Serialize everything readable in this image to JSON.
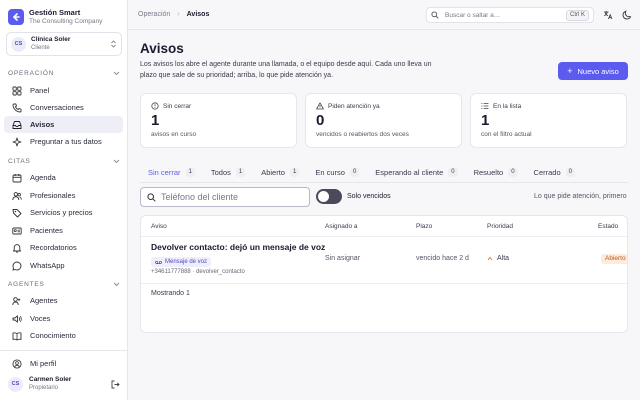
{
  "brand": {
    "name": "Gestión Smart",
    "subtitle": "The Consulting Company"
  },
  "client": {
    "initials": "CS",
    "name": "Clínica Soler",
    "role": "Cliente"
  },
  "sidebar": {
    "sections": [
      {
        "label": "OPERACIÓN",
        "items": [
          {
            "label": "Panel",
            "icon": "grid-icon"
          },
          {
            "label": "Conversaciones",
            "icon": "phone-icon"
          },
          {
            "label": "Avisos",
            "icon": "inbox-icon",
            "active": true
          },
          {
            "label": "Preguntar a tus datos",
            "icon": "sparkle-icon"
          }
        ]
      },
      {
        "label": "CITAS",
        "items": [
          {
            "label": "Agenda",
            "icon": "calendar-icon"
          },
          {
            "label": "Profesionales",
            "icon": "users-icon"
          },
          {
            "label": "Servicios y precios",
            "icon": "tag-icon"
          },
          {
            "label": "Pacientes",
            "icon": "id-card-icon"
          },
          {
            "label": "Recordatorios",
            "icon": "bell-icon"
          },
          {
            "label": "WhatsApp",
            "icon": "whatsapp-icon"
          }
        ]
      },
      {
        "label": "AGENTES",
        "items": [
          {
            "label": "Agentes",
            "icon": "agents-icon"
          },
          {
            "label": "Voces",
            "icon": "voice-icon"
          },
          {
            "label": "Conocimiento",
            "icon": "book-icon"
          }
        ]
      }
    ],
    "profile_label": "Mi perfil",
    "user": {
      "initials": "CS",
      "name": "Carmen Soler",
      "role": "Propietario"
    }
  },
  "topbar": {
    "breadcrumb": [
      "Operación",
      "Avisos"
    ],
    "search_placeholder": "Buscar o saltar a…",
    "shortcut": "Ctrl K"
  },
  "page": {
    "title": "Avisos",
    "description": "Los avisos los abre el agente durante una llamada, o el equipo desde aquí. Cada uno lleva un plazo que sale de su prioridad; arriba, lo que pide atención ya.",
    "new_button": "Nuevo aviso"
  },
  "stats": [
    {
      "label": "Sin cerrar",
      "value": "1",
      "sub": "avisos en curso",
      "icon": "alert-circle-icon"
    },
    {
      "label": "Piden atención ya",
      "value": "0",
      "sub": "vencidos o reabiertos dos veces",
      "icon": "warning-icon"
    },
    {
      "label": "En la lista",
      "value": "1",
      "sub": "con el filtro actual",
      "icon": "list-icon"
    }
  ],
  "tabs": [
    {
      "label": "Sin cerrar",
      "count": "1",
      "active": true
    },
    {
      "label": "Todos",
      "count": "1"
    },
    {
      "label": "Abierto",
      "count": "1"
    },
    {
      "label": "En curso",
      "count": "0"
    },
    {
      "label": "Esperando al cliente",
      "count": "0"
    },
    {
      "label": "Resuelto",
      "count": "0"
    },
    {
      "label": "Cerrado",
      "count": "0"
    }
  ],
  "filters": {
    "phone_placeholder": "Teléfono del cliente",
    "overdue_only_label": "Solo vencidos",
    "overdue_only": false,
    "sort_label": "Lo que pide atención, primero"
  },
  "table": {
    "headers": {
      "aviso": "Aviso",
      "asignado": "Asignado a",
      "plazo": "Plazo",
      "prioridad": "Prioridad",
      "estado": "Estado"
    },
    "rows": [
      {
        "title": "Devolver contacto: dejó un mensaje de voz",
        "tag": "Mensaje de voz",
        "meta": "+34611777888 · devolver_contacto",
        "assigned": "Sin asignar",
        "due": "vencido hace 2 d",
        "priority": "Alta",
        "status": "Abierto"
      }
    ],
    "footer": "Mostrando 1"
  },
  "colors": {
    "accent": "#5b5bf0",
    "status_open_bg": "#fdecde",
    "status_open_fg": "#c25a14",
    "priority_high": "#e07a1f"
  }
}
